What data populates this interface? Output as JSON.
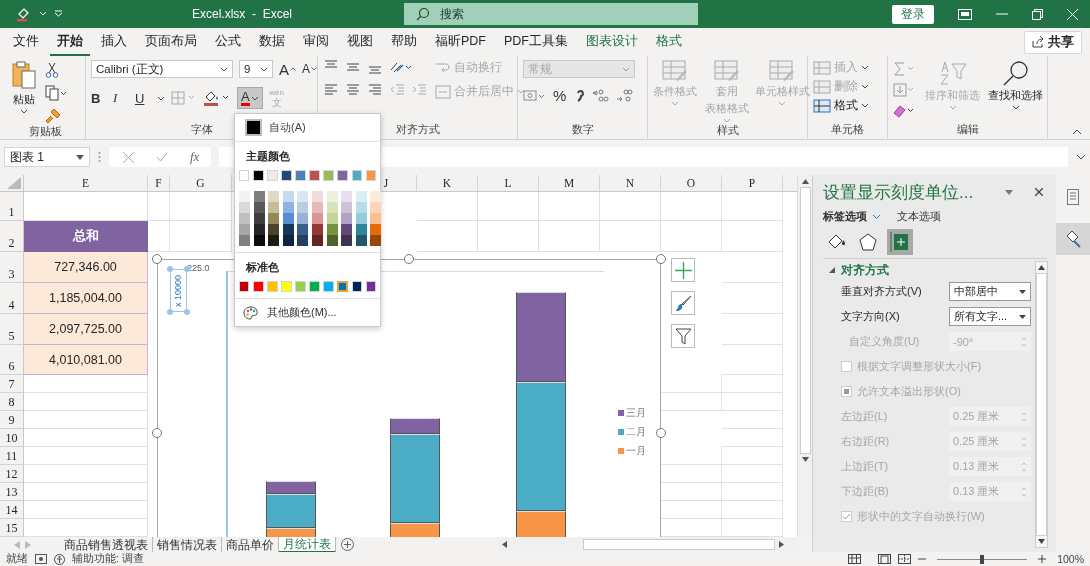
{
  "window": {
    "title": "Excel.xlsx  -  Excel",
    "search_placeholder": "搜索",
    "sign_in": "登录"
  },
  "ribbon_tabs": [
    {
      "label": "文件",
      "selected": false,
      "kind": "normal"
    },
    {
      "label": "开始",
      "selected": true,
      "kind": "normal"
    },
    {
      "label": "插入",
      "selected": false,
      "kind": "normal"
    },
    {
      "label": "页面布局",
      "selected": false,
      "kind": "normal"
    },
    {
      "label": "公式",
      "selected": false,
      "kind": "normal"
    },
    {
      "label": "数据",
      "selected": false,
      "kind": "normal"
    },
    {
      "label": "审阅",
      "selected": false,
      "kind": "normal"
    },
    {
      "label": "视图",
      "selected": false,
      "kind": "normal"
    },
    {
      "label": "帮助",
      "selected": false,
      "kind": "normal"
    },
    {
      "label": "福昕PDF",
      "selected": false,
      "kind": "normal"
    },
    {
      "label": "PDF工具集",
      "selected": false,
      "kind": "normal"
    },
    {
      "label": "图表设计",
      "selected": false,
      "kind": "contextual"
    },
    {
      "label": "格式",
      "selected": false,
      "kind": "contextual"
    }
  ],
  "share": "共享",
  "clipboard": {
    "paste": "粘贴",
    "group": "剪贴板"
  },
  "font": {
    "name": "Calibri (正文)",
    "size": "9",
    "grow": "A",
    "shrink": "A",
    "bold": "B",
    "italic": "I",
    "underline": "U",
    "color_letter": "A",
    "color_menu_open": true,
    "phonetic_top": "wén",
    "phonetic": "文",
    "phonetic_disabled": true,
    "group": "字体"
  },
  "alignment": {
    "wrap": {
      "label": "自动换行",
      "disabled": true
    },
    "merge": {
      "label": "合并后居中",
      "disabled": true
    },
    "group": "对齐方式"
  },
  "number": {
    "format": "常规",
    "disabled": true,
    "percent": "%",
    "group": "数字"
  },
  "styles": {
    "buttons": [
      {
        "lines": [
          "条件格式"
        ],
        "disabled": true
      },
      {
        "lines": [
          "套用",
          "表格格式"
        ],
        "disabled": true
      },
      {
        "lines": [
          "单元格样式"
        ],
        "disabled": true
      }
    ],
    "group": "样式"
  },
  "cells": {
    "buttons": [
      {
        "label": "插入",
        "disabled": true
      },
      {
        "label": "删除",
        "disabled": true
      },
      {
        "label": "格式",
        "disabled": false
      }
    ],
    "group": "单元格"
  },
  "editing": {
    "sort": {
      "label": "排序和筛选",
      "disabled": true
    },
    "find": {
      "label": "查找和选择",
      "disabled": false
    },
    "group": "编辑"
  },
  "formula_bar": {
    "name_box": "图表 1",
    "fx": "fx"
  },
  "columns": [
    "E",
    "F",
    "G",
    "J",
    "K",
    "L",
    "M",
    "N",
    "O",
    "P"
  ],
  "rows": [
    "1",
    "2",
    "3",
    "4",
    "5",
    "6",
    "7",
    "8",
    "9",
    "10",
    "11",
    "12",
    "13",
    "14",
    "15"
  ],
  "table": {
    "header": "总和",
    "values": [
      "727,346.00",
      "1,185,004.00",
      "2,097,725.00",
      "4,010,081.00"
    ]
  },
  "chart": {
    "axis_unit": "x 10000",
    "axis_label": "225.0",
    "legend": [
      {
        "name": "三月",
        "color": "#8064a2"
      },
      {
        "name": "二月",
        "color": "#4bacc6"
      },
      {
        "name": "一月",
        "color": "#f79646"
      }
    ]
  },
  "color_menu": {
    "auto": "自动(A)",
    "theme_title": "主题颜色",
    "theme_colors": [
      {
        "color": "#ffffff",
        "shades": [
          {
            "color": "#f2f2f2"
          },
          {
            "color": "#d9d9d9"
          },
          {
            "color": "#bfbfbf"
          },
          {
            "color": "#a6a6a6"
          },
          {
            "color": "#808080"
          }
        ]
      },
      {
        "color": "#000000",
        "shades": [
          {
            "color": "#7f7f7f"
          },
          {
            "color": "#595959"
          },
          {
            "color": "#3f3f3f"
          },
          {
            "color": "#262626"
          },
          {
            "color": "#0c0c0c"
          }
        ]
      },
      {
        "color": "#eeece1",
        "shades": [
          {
            "color": "#ddd9c3"
          },
          {
            "color": "#c4bd97"
          },
          {
            "color": "#938953"
          },
          {
            "color": "#494429"
          },
          {
            "color": "#1d1b10"
          }
        ]
      },
      {
        "color": "#1f497d",
        "shades": [
          {
            "color": "#c6d9f0"
          },
          {
            "color": "#8db3e2"
          },
          {
            "color": "#548dd4"
          },
          {
            "color": "#17365d"
          },
          {
            "color": "#0f243e"
          }
        ]
      },
      {
        "color": "#4f81bd",
        "shades": [
          {
            "color": "#dbe5f1"
          },
          {
            "color": "#b8cce4"
          },
          {
            "color": "#95b3d7"
          },
          {
            "color": "#366092"
          },
          {
            "color": "#244061"
          }
        ]
      },
      {
        "color": "#c0504d",
        "shades": [
          {
            "color": "#f2dcdb"
          },
          {
            "color": "#e5b9b7"
          },
          {
            "color": "#d99694"
          },
          {
            "color": "#953734"
          },
          {
            "color": "#632423"
          }
        ]
      },
      {
        "color": "#9bbb59",
        "shades": [
          {
            "color": "#ebf1dd"
          },
          {
            "color": "#d7e3bc"
          },
          {
            "color": "#c3d69b"
          },
          {
            "color": "#76923c"
          },
          {
            "color": "#4f6128"
          }
        ]
      },
      {
        "color": "#8064a2",
        "shades": [
          {
            "color": "#e5e0ec"
          },
          {
            "color": "#ccc1d9"
          },
          {
            "color": "#b2a2c7"
          },
          {
            "color": "#5f497a"
          },
          {
            "color": "#3f3151"
          }
        ]
      },
      {
        "color": "#4bacc6",
        "shades": [
          {
            "color": "#dbeef3"
          },
          {
            "color": "#b7dde8"
          },
          {
            "color": "#92cddc"
          },
          {
            "color": "#31859b"
          },
          {
            "color": "#205867"
          }
        ]
      },
      {
        "color": "#f79646",
        "shades": [
          {
            "color": "#fdeada"
          },
          {
            "color": "#fbd5b5"
          },
          {
            "color": "#fac08f"
          },
          {
            "color": "#e36c09"
          },
          {
            "color": "#974806"
          }
        ]
      }
    ],
    "standard_title": "标准色",
    "standard_colors": [
      {
        "color": "#c00000",
        "selected": false
      },
      {
        "color": "#ff0000",
        "selected": false
      },
      {
        "color": "#ffc000",
        "selected": false
      },
      {
        "color": "#ffff00",
        "selected": false
      },
      {
        "color": "#92d050",
        "selected": false
      },
      {
        "color": "#00b050",
        "selected": false
      },
      {
        "color": "#00b0f0",
        "selected": false
      },
      {
        "color": "#0070c0",
        "selected": true
      },
      {
        "color": "#002060",
        "selected": false
      },
      {
        "color": "#7030a0",
        "selected": false
      }
    ],
    "more": "其他颜色(M)..."
  },
  "format_pane": {
    "title": "设置显示刻度单位...",
    "tabs": [
      {
        "label": "标签选项",
        "selected": true
      },
      {
        "label": "文本选项",
        "selected": false
      }
    ],
    "icon_tabs": [
      {
        "kind": "fill",
        "selected": false
      },
      {
        "kind": "shape",
        "selected": false
      },
      {
        "kind": "size",
        "selected": true
      }
    ],
    "section": {
      "title": "对齐方式",
      "expanded": true
    },
    "rows": [
      {
        "kind": "dropdown",
        "label": "垂直对齐方式(V)",
        "value": "中部居中",
        "disabled": false
      },
      {
        "kind": "dropdown",
        "label": "文字方向(X)",
        "value": "所有文字...",
        "disabled": false,
        "children": [
          {
            "kind": "spinner",
            "label": "自定义角度(U)",
            "value": "-90°",
            "disabled": true
          }
        ]
      },
      {
        "kind": "checkbox",
        "label": "根据文字调整形状大小(F)",
        "checked": false,
        "mixed": false,
        "disabled": true
      },
      {
        "kind": "checkbox",
        "label": "允许文本溢出形状(O)",
        "checked": false,
        "mixed": true,
        "disabled": true
      },
      {
        "kind": "spinner",
        "label": "左边距(L)",
        "value": "0.25 厘米",
        "disabled": true
      },
      {
        "kind": "spinner",
        "label": "右边距(R)",
        "value": "0.25 厘米",
        "disabled": true
      },
      {
        "kind": "spinner",
        "label": "上边距(T)",
        "value": "0.13 厘米",
        "disabled": true
      },
      {
        "kind": "spinner",
        "label": "下边距(B)",
        "value": "0.13 厘米",
        "disabled": true
      },
      {
        "kind": "checkbox",
        "label": "形状中的文字自动换行(W)",
        "checked": true,
        "mixed": false,
        "disabled": true
      }
    ]
  },
  "sheet_tabs": [
    {
      "label": "商品销售透视表",
      "selected": false
    },
    {
      "label": "销售情况表",
      "selected": false
    },
    {
      "label": "商品单价",
      "selected": false
    },
    {
      "label": "月统计表",
      "selected": true
    }
  ],
  "status_bar": {
    "ready": "就绪",
    "accessibility": "辅助功能: 调查",
    "zoom": "100%",
    "zoom_slider": {
      "level": 0.5
    }
  }
}
